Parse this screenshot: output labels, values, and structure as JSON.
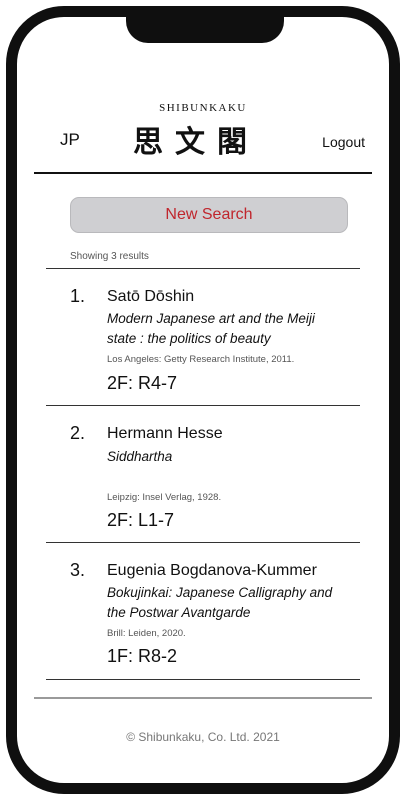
{
  "header": {
    "brand_small": "SHIBUNKAKU",
    "logo_text": "思文閣",
    "lang_label": "JP",
    "logout_label": "Logout"
  },
  "search": {
    "new_search_label": "New Search",
    "results_summary": "Showing 3 results"
  },
  "results": [
    {
      "number": "1.",
      "author": "Satō Dōshin",
      "title": "Modern Japanese art and the Meiji state : the politics of beauty",
      "publication": "Los Angeles: Getty Research Institute, 2011.",
      "location": "2F: R4-7"
    },
    {
      "number": "2.",
      "author": "Hermann Hesse",
      "title": "Siddhartha",
      "publication": "Leipzig: Insel Verlag, 1928.",
      "location": "2F: L1-7"
    },
    {
      "number": "3.",
      "author": "Eugenia Bogdanova-Kummer",
      "title": "Bokujinkai: Japanese Calligraphy and the Postwar Avantgarde",
      "publication": "Brill: Leiden, 2020.",
      "location": "1F: R8-2"
    }
  ],
  "footer": {
    "copyright": "© Shibunkaku, Co. Ltd. 2021"
  },
  "colors": {
    "accent": "#c0262d",
    "button_bg": "#cfcfd2"
  }
}
